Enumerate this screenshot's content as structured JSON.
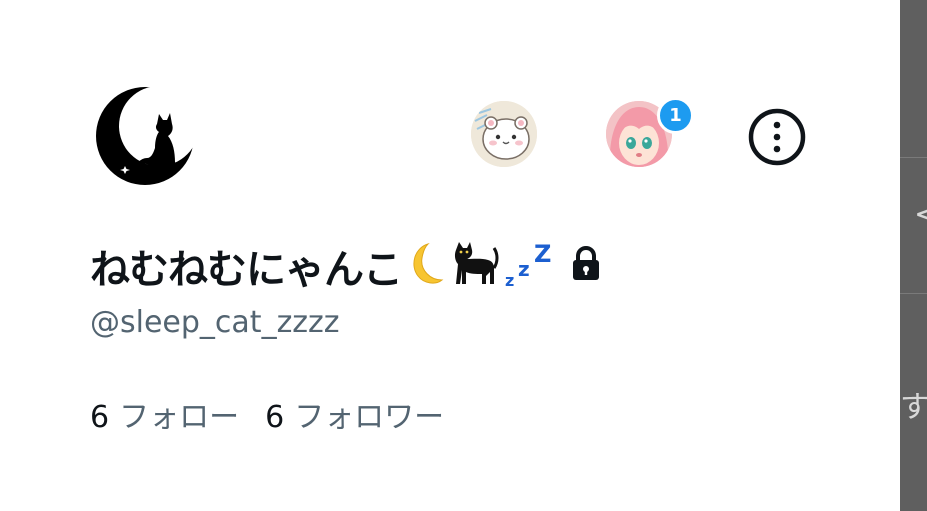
{
  "profile": {
    "display_name": "ねむねむにゃんこ",
    "handle": "@sleep_cat_zzzz",
    "locked": true,
    "avatar_icon": "crescent-moon-cat-icon"
  },
  "accounts": {
    "account1_avatar": "hamster-avatar",
    "account2_avatar": "pink-hair-girl-avatar",
    "account2_badge": "1"
  },
  "stats": {
    "following_count": "6",
    "following_label": "フォロー",
    "followers_count": "6",
    "followers_label": "フォロワー"
  },
  "behind_panel": {
    "partial_text": "す"
  },
  "colors": {
    "text_primary": "#0f1419",
    "text_secondary": "#536471",
    "badge": "#1d9bf0",
    "overlay": "#5f5f5f"
  }
}
